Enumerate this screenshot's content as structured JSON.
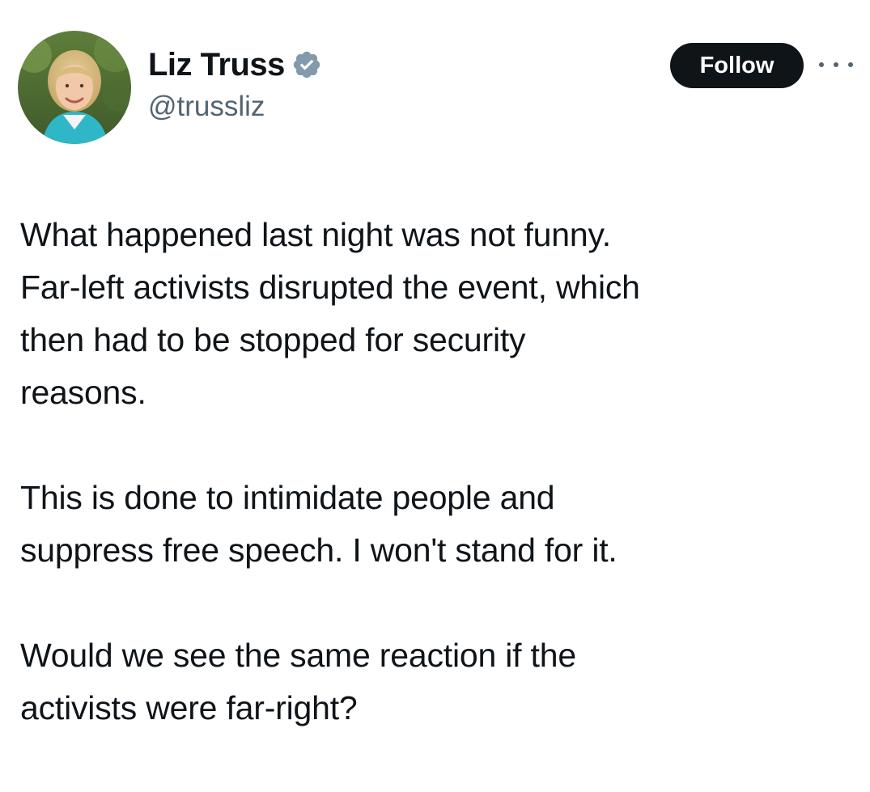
{
  "author": {
    "display_name": "Liz Truss",
    "handle": "@trussliz",
    "verified": true,
    "verified_badge_color": "#829aab"
  },
  "actions": {
    "follow_label": "Follow",
    "follow_bg": "#0f1419",
    "more_icon": "more-horizontal-icon"
  },
  "tweet": {
    "paragraphs": [
      "What happened last night was not funny.\nFar-left activists disrupted the event, which\nthen had to be stopped for security\nreasons.",
      "This is done to intimidate people and\nsuppress free speech. I won't stand for it.",
      "Would we see the same reaction if the\nactivists were far-right?"
    ]
  },
  "colors": {
    "text_primary": "#0f1419",
    "text_secondary": "#536471",
    "background": "#ffffff"
  }
}
